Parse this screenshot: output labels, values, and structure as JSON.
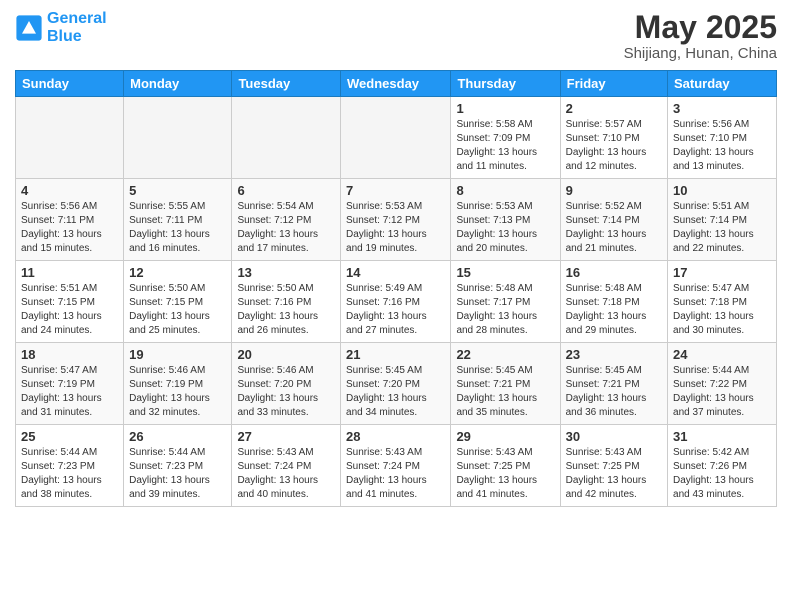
{
  "logo": {
    "line1": "General",
    "line2": "Blue"
  },
  "title": "May 2025",
  "subtitle": "Shijiang, Hunan, China",
  "days_of_week": [
    "Sunday",
    "Monday",
    "Tuesday",
    "Wednesday",
    "Thursday",
    "Friday",
    "Saturday"
  ],
  "weeks": [
    [
      {
        "day": "",
        "info": ""
      },
      {
        "day": "",
        "info": ""
      },
      {
        "day": "",
        "info": ""
      },
      {
        "day": "",
        "info": ""
      },
      {
        "day": "1",
        "info": "Sunrise: 5:58 AM\nSunset: 7:09 PM\nDaylight: 13 hours and 11 minutes."
      },
      {
        "day": "2",
        "info": "Sunrise: 5:57 AM\nSunset: 7:10 PM\nDaylight: 13 hours and 12 minutes."
      },
      {
        "day": "3",
        "info": "Sunrise: 5:56 AM\nSunset: 7:10 PM\nDaylight: 13 hours and 13 minutes."
      }
    ],
    [
      {
        "day": "4",
        "info": "Sunrise: 5:56 AM\nSunset: 7:11 PM\nDaylight: 13 hours and 15 minutes."
      },
      {
        "day": "5",
        "info": "Sunrise: 5:55 AM\nSunset: 7:11 PM\nDaylight: 13 hours and 16 minutes."
      },
      {
        "day": "6",
        "info": "Sunrise: 5:54 AM\nSunset: 7:12 PM\nDaylight: 13 hours and 17 minutes."
      },
      {
        "day": "7",
        "info": "Sunrise: 5:53 AM\nSunset: 7:12 PM\nDaylight: 13 hours and 19 minutes."
      },
      {
        "day": "8",
        "info": "Sunrise: 5:53 AM\nSunset: 7:13 PM\nDaylight: 13 hours and 20 minutes."
      },
      {
        "day": "9",
        "info": "Sunrise: 5:52 AM\nSunset: 7:14 PM\nDaylight: 13 hours and 21 minutes."
      },
      {
        "day": "10",
        "info": "Sunrise: 5:51 AM\nSunset: 7:14 PM\nDaylight: 13 hours and 22 minutes."
      }
    ],
    [
      {
        "day": "11",
        "info": "Sunrise: 5:51 AM\nSunset: 7:15 PM\nDaylight: 13 hours and 24 minutes."
      },
      {
        "day": "12",
        "info": "Sunrise: 5:50 AM\nSunset: 7:15 PM\nDaylight: 13 hours and 25 minutes."
      },
      {
        "day": "13",
        "info": "Sunrise: 5:50 AM\nSunset: 7:16 PM\nDaylight: 13 hours and 26 minutes."
      },
      {
        "day": "14",
        "info": "Sunrise: 5:49 AM\nSunset: 7:16 PM\nDaylight: 13 hours and 27 minutes."
      },
      {
        "day": "15",
        "info": "Sunrise: 5:48 AM\nSunset: 7:17 PM\nDaylight: 13 hours and 28 minutes."
      },
      {
        "day": "16",
        "info": "Sunrise: 5:48 AM\nSunset: 7:18 PM\nDaylight: 13 hours and 29 minutes."
      },
      {
        "day": "17",
        "info": "Sunrise: 5:47 AM\nSunset: 7:18 PM\nDaylight: 13 hours and 30 minutes."
      }
    ],
    [
      {
        "day": "18",
        "info": "Sunrise: 5:47 AM\nSunset: 7:19 PM\nDaylight: 13 hours and 31 minutes."
      },
      {
        "day": "19",
        "info": "Sunrise: 5:46 AM\nSunset: 7:19 PM\nDaylight: 13 hours and 32 minutes."
      },
      {
        "day": "20",
        "info": "Sunrise: 5:46 AM\nSunset: 7:20 PM\nDaylight: 13 hours and 33 minutes."
      },
      {
        "day": "21",
        "info": "Sunrise: 5:45 AM\nSunset: 7:20 PM\nDaylight: 13 hours and 34 minutes."
      },
      {
        "day": "22",
        "info": "Sunrise: 5:45 AM\nSunset: 7:21 PM\nDaylight: 13 hours and 35 minutes."
      },
      {
        "day": "23",
        "info": "Sunrise: 5:45 AM\nSunset: 7:21 PM\nDaylight: 13 hours and 36 minutes."
      },
      {
        "day": "24",
        "info": "Sunrise: 5:44 AM\nSunset: 7:22 PM\nDaylight: 13 hours and 37 minutes."
      }
    ],
    [
      {
        "day": "25",
        "info": "Sunrise: 5:44 AM\nSunset: 7:23 PM\nDaylight: 13 hours and 38 minutes."
      },
      {
        "day": "26",
        "info": "Sunrise: 5:44 AM\nSunset: 7:23 PM\nDaylight: 13 hours and 39 minutes."
      },
      {
        "day": "27",
        "info": "Sunrise: 5:43 AM\nSunset: 7:24 PM\nDaylight: 13 hours and 40 minutes."
      },
      {
        "day": "28",
        "info": "Sunrise: 5:43 AM\nSunset: 7:24 PM\nDaylight: 13 hours and 41 minutes."
      },
      {
        "day": "29",
        "info": "Sunrise: 5:43 AM\nSunset: 7:25 PM\nDaylight: 13 hours and 41 minutes."
      },
      {
        "day": "30",
        "info": "Sunrise: 5:43 AM\nSunset: 7:25 PM\nDaylight: 13 hours and 42 minutes."
      },
      {
        "day": "31",
        "info": "Sunrise: 5:42 AM\nSunset: 7:26 PM\nDaylight: 13 hours and 43 minutes."
      }
    ]
  ]
}
